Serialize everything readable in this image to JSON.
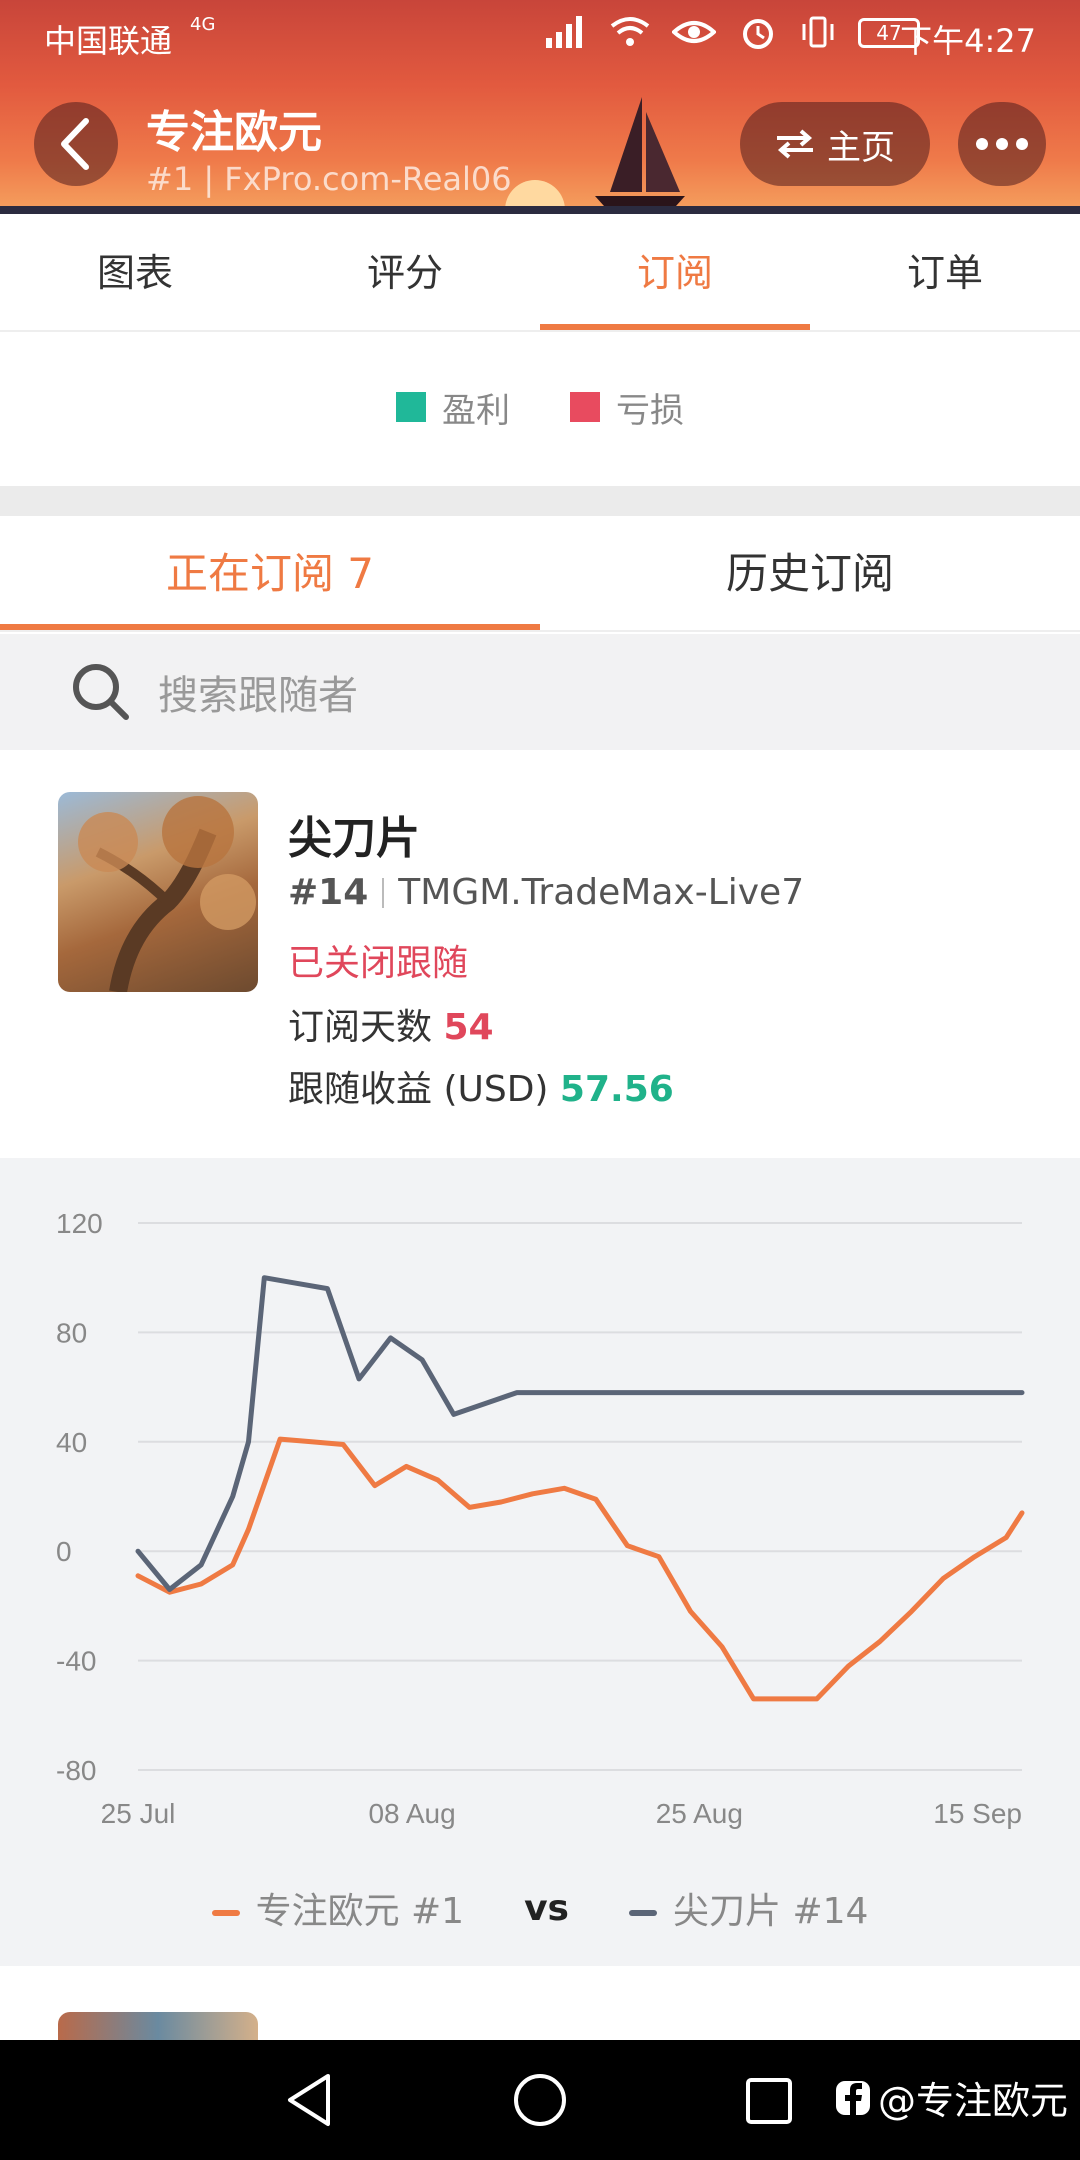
{
  "status_bar": {
    "carrier": "中国联通",
    "network": "4G",
    "battery": "47",
    "time": "下午4:27"
  },
  "header": {
    "title": "专注欧元",
    "subtitle": "#1 | FxPro.com-Real06",
    "home_label": "主页"
  },
  "main_tabs": [
    {
      "label": "图表",
      "active": false
    },
    {
      "label": "评分",
      "active": false
    },
    {
      "label": "订阅",
      "active": true
    },
    {
      "label": "订单",
      "active": false
    }
  ],
  "top_legend": {
    "profit": "盈利",
    "loss": "亏损",
    "profit_color": "#20b899",
    "loss_color": "#e84b5f"
  },
  "sub_tabs": [
    {
      "label": "正在订阅 7",
      "active": true
    },
    {
      "label": "历史订阅",
      "active": false
    }
  ],
  "search": {
    "placeholder": "搜索跟随者"
  },
  "follower": {
    "name": "尖刀片",
    "rank": "#14",
    "server": "TMGM.TradeMax-Live7",
    "status": "已关闭跟随",
    "days_label": "订阅天数",
    "days_value": "54",
    "profit_label": "跟随收益 (USD)",
    "profit_value": "57.56"
  },
  "chart_data": {
    "type": "line",
    "x": [
      "25 Jul",
      "08 Aug",
      "25 Aug",
      "15 Sep"
    ],
    "y_ticks": [
      120,
      80,
      40,
      0,
      -40,
      -80
    ],
    "ylim": [
      -80,
      120
    ],
    "grid": true,
    "legend_placement": "bottom",
    "series": [
      {
        "name": "专注欧元 #1",
        "color": "#ef7a43",
        "points": [
          [
            0,
            -9
          ],
          [
            2,
            -15
          ],
          [
            4,
            -12
          ],
          [
            6,
            -5
          ],
          [
            7,
            8
          ],
          [
            9,
            41
          ],
          [
            11,
            40
          ],
          [
            13,
            39
          ],
          [
            15,
            24
          ],
          [
            17,
            31
          ],
          [
            19,
            26
          ],
          [
            21,
            16
          ],
          [
            23,
            18
          ],
          [
            25,
            21
          ],
          [
            27,
            23
          ],
          [
            29,
            19
          ],
          [
            31,
            2
          ],
          [
            33,
            -2
          ],
          [
            35,
            -22
          ],
          [
            37,
            -35
          ],
          [
            39,
            -54
          ],
          [
            41,
            -54
          ],
          [
            43,
            -54
          ],
          [
            45,
            -42
          ],
          [
            47,
            -33
          ],
          [
            49,
            -22
          ],
          [
            51,
            -10
          ],
          [
            53,
            -2
          ],
          [
            55,
            5
          ],
          [
            56,
            14
          ]
        ]
      },
      {
        "name": "尖刀片 #14",
        "color": "#5b6577",
        "points": [
          [
            0,
            0
          ],
          [
            2,
            -14
          ],
          [
            4,
            -5
          ],
          [
            6,
            20
          ],
          [
            7,
            40
          ],
          [
            8,
            100
          ],
          [
            10,
            98
          ],
          [
            12,
            96
          ],
          [
            14,
            63
          ],
          [
            16,
            78
          ],
          [
            18,
            70
          ],
          [
            20,
            50
          ],
          [
            22,
            54
          ],
          [
            24,
            58
          ],
          [
            30,
            58
          ],
          [
            40,
            58
          ],
          [
            50,
            58
          ],
          [
            56,
            58
          ]
        ]
      }
    ]
  },
  "bottom_legend": {
    "series1": "专注欧元 #1",
    "vs": "vs",
    "series2": "尖刀片 #14"
  },
  "watermark": "@专注欧元"
}
